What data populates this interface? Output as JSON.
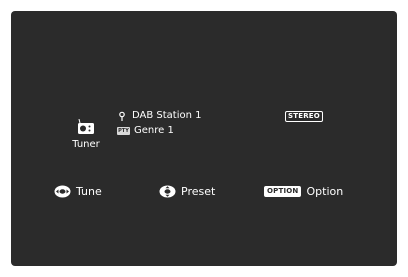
{
  "source": {
    "label": "Tuner"
  },
  "station": {
    "name": "DAB Station 1"
  },
  "genre": {
    "name": "Genre 1",
    "icon_label": "PTY"
  },
  "mode_badge": "STEREO",
  "controls": {
    "tune_label": "Tune",
    "preset_label": "Preset",
    "option_badge": "OPTION",
    "option_label": "Option"
  },
  "icons": {
    "source": "radio-icon",
    "station": "antenna-icon",
    "genre": "genre-tag-icon",
    "tune": "dpad-left-right-icon",
    "preset": "dpad-up-down-icon"
  },
  "colors": {
    "screen_bg": "#2b2b2b",
    "text": "#ffffff"
  }
}
